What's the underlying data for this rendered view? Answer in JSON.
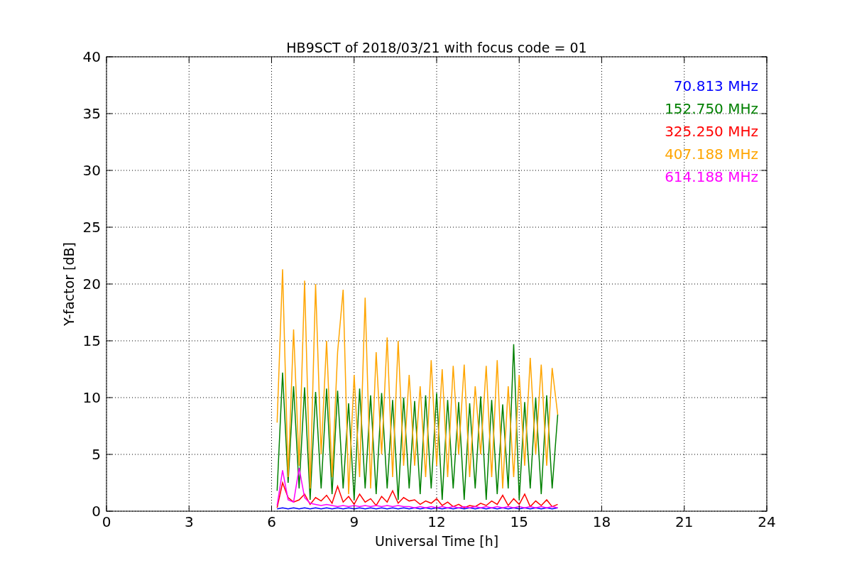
{
  "chart_data": {
    "type": "line",
    "title": "HB9SCT of 2018/03/21 with focus code = 01",
    "xlabel": "Universal Time [h]",
    "ylabel": "Y-factor [dB]",
    "x": [
      6.2,
      6.4,
      6.6,
      6.8,
      7.0,
      7.2,
      7.4,
      7.6,
      7.8,
      8.0,
      8.2,
      8.4,
      8.6,
      8.8,
      9.0,
      9.2,
      9.4,
      9.6,
      9.8,
      10.0,
      10.2,
      10.4,
      10.6,
      10.8,
      11.0,
      11.2,
      11.4,
      11.6,
      11.8,
      12.0,
      12.2,
      12.4,
      12.6,
      12.8,
      13.0,
      13.2,
      13.4,
      13.6,
      13.8,
      14.0,
      14.2,
      14.4,
      14.6,
      14.8,
      15.0,
      15.2,
      15.4,
      15.6,
      15.8,
      16.0,
      16.2,
      16.4
    ],
    "series": [
      {
        "name": "70.813 MHz",
        "color": "#0000ff",
        "values": [
          0.2,
          0.3,
          0.2,
          0.3,
          0.2,
          0.3,
          0.2,
          0.3,
          0.2,
          0.3,
          0.2,
          0.3,
          0.2,
          0.3,
          0.2,
          0.3,
          0.2,
          0.3,
          0.2,
          0.3,
          0.2,
          0.3,
          0.2,
          0.3,
          0.2,
          0.3,
          0.2,
          0.3,
          0.2,
          0.3,
          0.2,
          0.3,
          0.2,
          0.3,
          0.2,
          0.3,
          0.2,
          0.3,
          0.2,
          0.3,
          0.2,
          0.3,
          0.2,
          0.3,
          0.2,
          0.3,
          0.2,
          0.3,
          0.2,
          0.3,
          0.2,
          0.3
        ]
      },
      {
        "name": "152.750 MHz",
        "color": "#008000",
        "values": [
          1.8,
          12.2,
          2.5,
          11,
          2,
          10.9,
          1,
          10.5,
          2,
          10.8,
          1.5,
          10.6,
          2,
          9.5,
          1,
          10.8,
          2,
          10.2,
          1.5,
          10.4,
          2,
          9.8,
          1,
          10,
          2,
          9.7,
          1.5,
          10.2,
          2,
          10.4,
          1,
          9.8,
          2,
          9.6,
          1,
          9.5,
          2,
          10.1,
          1,
          9.8,
          1.5,
          9.4,
          2,
          14.7,
          1,
          9.6,
          2,
          10,
          1.5,
          10.2,
          2,
          8.5
        ]
      },
      {
        "name": "325.250 MHz",
        "color": "#ff0000",
        "values": [
          0.3,
          2.5,
          1.2,
          0.8,
          1.0,
          1.5,
          0.6,
          1.2,
          0.9,
          1.4,
          0.7,
          2.2,
          0.8,
          1.3,
          0.6,
          1.5,
          0.8,
          1.1,
          0.5,
          1.3,
          0.8,
          1.8,
          0.7,
          1.2,
          0.9,
          1.0,
          0.6,
          0.9,
          0.7,
          1.1,
          0.5,
          0.8,
          0.4,
          0.6,
          0.3,
          0.5,
          0.4,
          0.7,
          0.5,
          0.9,
          0.6,
          1.4,
          0.5,
          1.1,
          0.6,
          1.5,
          0.4,
          0.9,
          0.5,
          1.0,
          0.4,
          0.6
        ]
      },
      {
        "name": "407.188 MHz",
        "color": "#ffa500",
        "values": [
          7.8,
          21.3,
          3,
          16,
          4,
          20.3,
          2,
          20,
          5,
          15,
          3,
          14,
          19.5,
          1.5,
          12,
          3,
          18.8,
          2,
          14,
          5,
          15.3,
          3,
          15,
          4,
          12,
          4,
          11,
          3,
          13.3,
          4,
          12.5,
          3,
          12.8,
          5,
          12.9,
          3,
          11,
          5,
          12.8,
          3,
          13.3,
          2,
          11,
          3,
          12,
          4,
          13.5,
          5,
          12.9,
          4,
          12.6,
          8.5
        ]
      },
      {
        "name": "614.188 MHz",
        "color": "#ff00ff",
        "values": [
          0.5,
          3.6,
          1.0,
          0.8,
          3.8,
          1.2,
          0.7,
          0.6,
          0.5,
          0.6,
          0.5,
          0.4,
          0.5,
          0.4,
          0.5,
          0.4,
          0.5,
          0.4,
          0.5,
          0.4,
          0.5,
          0.4,
          0.5,
          0.4,
          0.4,
          0.3,
          0.4,
          0.3,
          0.4,
          0.3,
          0.4,
          0.3,
          0.4,
          0.3,
          0.4,
          0.3,
          0.4,
          0.3,
          0.4,
          0.3,
          0.4,
          0.3,
          0.4,
          0.3,
          0.4,
          0.3,
          0.4,
          0.3,
          0.4,
          0.3,
          0.4,
          0.3
        ]
      }
    ],
    "grid": true,
    "xlim": [
      0,
      24
    ],
    "ylim": [
      0,
      40
    ],
    "xticks": [
      0,
      3,
      6,
      9,
      12,
      15,
      18,
      21,
      24
    ],
    "yticks": [
      0,
      5,
      10,
      15,
      20,
      25,
      30,
      35,
      40
    ]
  }
}
